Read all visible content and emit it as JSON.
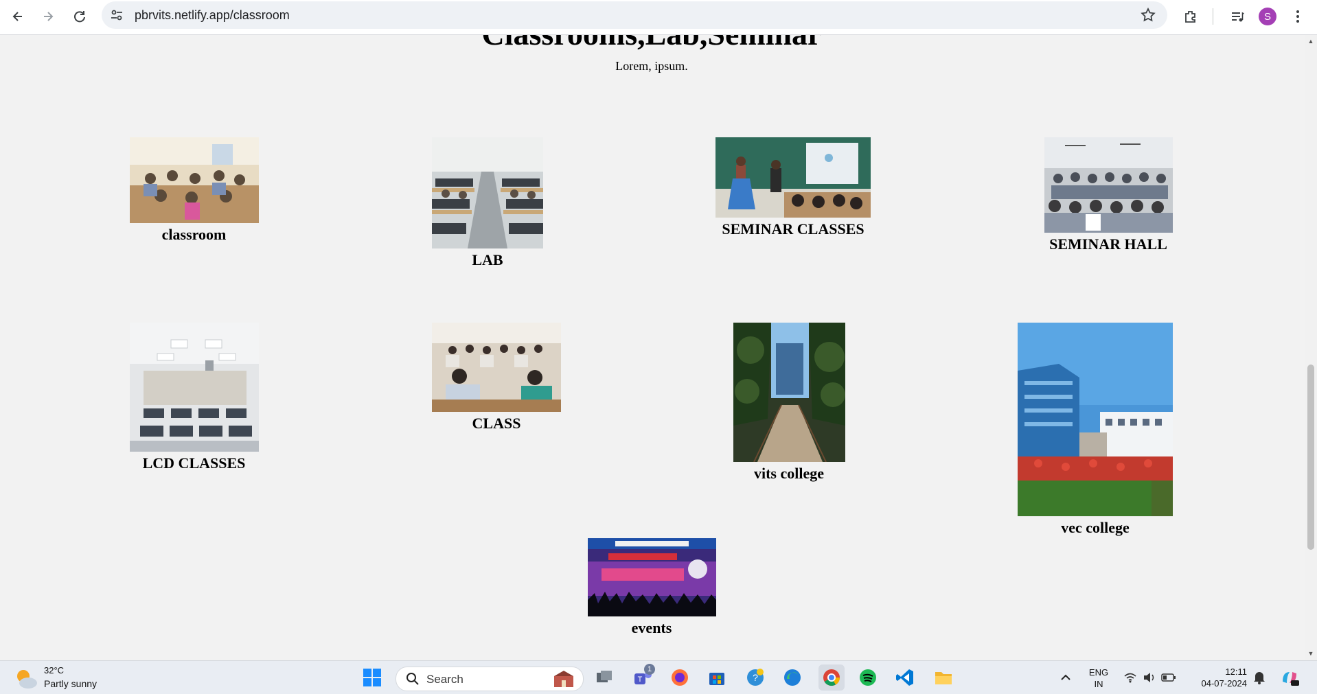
{
  "browser": {
    "url": "pbrvits.netlify.app/classroom",
    "profile_initial": "S"
  },
  "page": {
    "title": "Classrooms,Lab,Seminar",
    "subtitle": "Lorem, ipsum."
  },
  "gallery": [
    {
      "caption": "classroom",
      "photo": "classroom-photo"
    },
    {
      "caption": "LAB",
      "photo": "lab-photo"
    },
    {
      "caption": "SEMINAR CLASSES",
      "photo": "seminar-classes-photo"
    },
    {
      "caption": "SEMINAR HALL",
      "photo": "seminar-hall-photo"
    },
    {
      "caption": "LCD CLASSES",
      "photo": "lcd-classes-photo"
    },
    {
      "caption": "CLASS",
      "photo": "class-photo"
    },
    {
      "caption": "vits college",
      "photo": "vits-college-photo"
    },
    {
      "caption": "vec college",
      "photo": "vec-college-photo"
    },
    {
      "caption": "events",
      "photo": "events-banner-photo"
    }
  ],
  "taskbar": {
    "weather_temp": "32°C",
    "weather_condition": "Partly sunny",
    "search_label": "Search",
    "teams_badge": "1",
    "language_line1": "ENG",
    "language_line2": "IN",
    "time": "12:11",
    "date": "04-07-2024"
  },
  "colors": {
    "page_background": "#f2f2f2",
    "taskbar_background": "#e9edf3",
    "avatar": "#a43fb5"
  }
}
